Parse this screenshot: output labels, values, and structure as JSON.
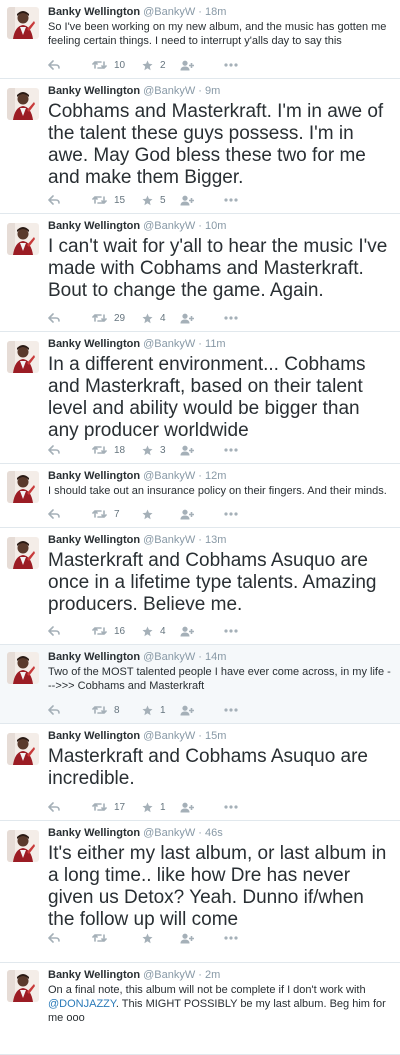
{
  "tweets": [
    {
      "name": "Banky Wellington",
      "handle": "@BankyW",
      "sep": "·",
      "time": "18m",
      "text": "So I've been working on my new album, and the music has gotten me feeling certain things. I need to interrupt y'alls day to say this",
      "retweets": "10",
      "favorites": "2"
    },
    {
      "name": "Banky Wellington",
      "handle": "@BankyW",
      "sep": "·",
      "time": "9m",
      "text": "Cobhams and Masterkraft. I'm in awe of the talent these guys possess. I'm in awe. May God bless these two for me and make them Bigger.",
      "retweets": "15",
      "favorites": "5"
    },
    {
      "name": "Banky Wellington",
      "handle": "@BankyW",
      "sep": "·",
      "time": "10m",
      "text": "I can't wait for y'all to hear the music I've made with Cobhams and Masterkraft. Bout to change the game. Again.",
      "retweets": "29",
      "favorites": "4"
    },
    {
      "name": "Banky Wellington",
      "handle": "@BankyW",
      "sep": "·",
      "time": "11m",
      "text": "In a different environment... Cobhams and Masterkraft, based on their talent level and ability would be bigger than any producer worldwide",
      "retweets": "18",
      "favorites": "3"
    },
    {
      "name": "Banky Wellington",
      "handle": "@BankyW",
      "sep": "·",
      "time": "12m",
      "text": "I should take out an insurance policy on their fingers. And their minds.",
      "retweets": "7",
      "favorites": ""
    },
    {
      "name": "Banky Wellington",
      "handle": "@BankyW",
      "sep": "·",
      "time": "13m",
      "text": "Masterkraft and Cobhams Asuquo are once in a lifetime type talents. Amazing producers. Believe me.",
      "retweets": "16",
      "favorites": "4"
    },
    {
      "name": "Banky Wellington",
      "handle": "@BankyW",
      "sep": "·",
      "time": "14m",
      "text": "Two of the MOST talented people I have ever come across, in my life --->>> Cobhams and Masterkraft",
      "retweets": "8",
      "favorites": "1"
    },
    {
      "name": "Banky Wellington",
      "handle": "@BankyW",
      "sep": "·",
      "time": "15m",
      "text": "Masterkraft and Cobhams Asuquo are incredible.",
      "retweets": "17",
      "favorites": "1"
    },
    {
      "name": "Banky Wellington",
      "handle": "@BankyW",
      "sep": "·",
      "time": "46s",
      "text": "It's either my last album, or last album in a long time.. like how Dre has never given us Detox? Yeah. Dunno if/when the follow up will come",
      "retweets": "",
      "favorites": ""
    },
    {
      "name": "Banky Wellington",
      "handle": "@BankyW",
      "sep": "·",
      "time": "2m",
      "text_before": "On a final note, this album will not be complete if I don't work with",
      "mention": "@DONJAZZY",
      "text_after": ". This MIGHT POSSIBLY be my last album. Beg him for me ooo",
      "retweets": "",
      "favorites": ""
    }
  ],
  "colors": {
    "accent": "#2b7bb9",
    "meta": "#8899a6",
    "text": "#292f33",
    "highlight_bg": "#f5f8fa"
  }
}
